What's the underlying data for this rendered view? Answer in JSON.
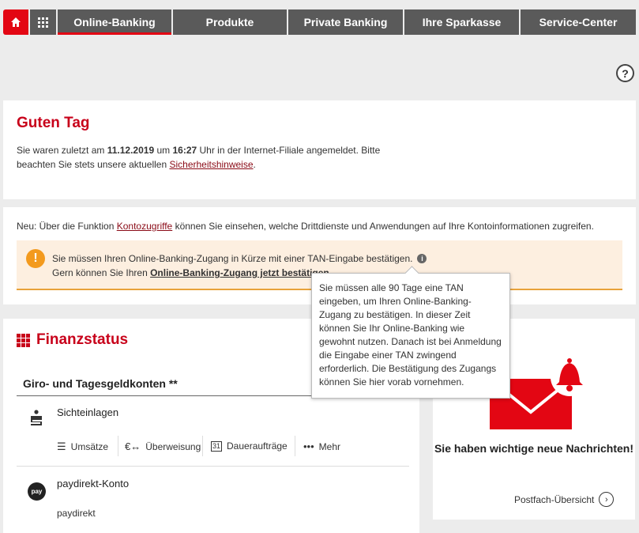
{
  "nav": {
    "tabs": [
      {
        "label": "Online-Banking",
        "active": true
      },
      {
        "label": "Produkte",
        "active": false
      },
      {
        "label": "Private Banking",
        "active": false
      },
      {
        "label": "Ihre Sparkasse",
        "active": false
      },
      {
        "label": "Service-Center",
        "active": false
      }
    ],
    "home_icon": "home-icon",
    "apps_icon": "grid-icon"
  },
  "help": {
    "label": "?"
  },
  "greeting": {
    "title": "Guten Tag",
    "text_1": "Sie waren zuletzt am ",
    "date": "11.12.2019",
    "text_2": " um ",
    "time": "16:27",
    "text_3": " Uhr in der Internet-Filiale angemeldet. Bitte beachten Sie stets unsere aktuellen ",
    "link": "Sicherheitshinweise",
    "text_4": "."
  },
  "notice": {
    "text_1": "Neu: Über die Funktion ",
    "link": "Kontozugriffe",
    "text_2": " können Sie einsehen, welche Drittdienste und Anwendungen auf Ihre Kontoinformationen zugreifen.",
    "warning_icon": "!",
    "warning_line1": "Sie müssen Ihren Online-Banking-Zugang in Kürze mit einer TAN-Eingabe bestätigen.",
    "info_icon": "i",
    "warning_line2_text": "Gern können Sie Ihren ",
    "warning_line2_link": "Online-Banking-Zugang jetzt bestätigen"
  },
  "tooltip": {
    "text": "Sie müssen alle 90 Tage eine TAN eingeben, um Ihren Online-Banking-Zugang zu bestätigen. In dieser Zeit können Sie Ihr Online-Banking wie gewohnt nutzen. Danach ist bei Anmeldung die Eingabe einer TAN zwingend erforderlich. Die Bestätigung des Zugangs können Sie hier vorab vornehmen."
  },
  "finanzstatus": {
    "title": "Finanzstatus",
    "section": "Giro- und Tagesgeldkonten **",
    "accounts": [
      {
        "name": "Sichteinlagen",
        "icon": "sparkasse-s-icon"
      },
      {
        "name": "paydirekt-Konto",
        "sub": "paydirekt",
        "icon_label": "pay"
      }
    ],
    "actions": [
      {
        "label": "Umsätze",
        "icon": "list-icon"
      },
      {
        "label": "Überweisung",
        "icon": "euro-transfer-icon"
      },
      {
        "label": "Daueraufträge",
        "icon": "calendar-icon",
        "icon_text": "31"
      },
      {
        "label": "Mehr",
        "icon": "more-dots-icon"
      }
    ]
  },
  "messages": {
    "title": "Sie haben wichtige neue Nachrichten!",
    "link": "Postfach-Übersicht",
    "colors": {
      "brand": "#e30613"
    }
  }
}
